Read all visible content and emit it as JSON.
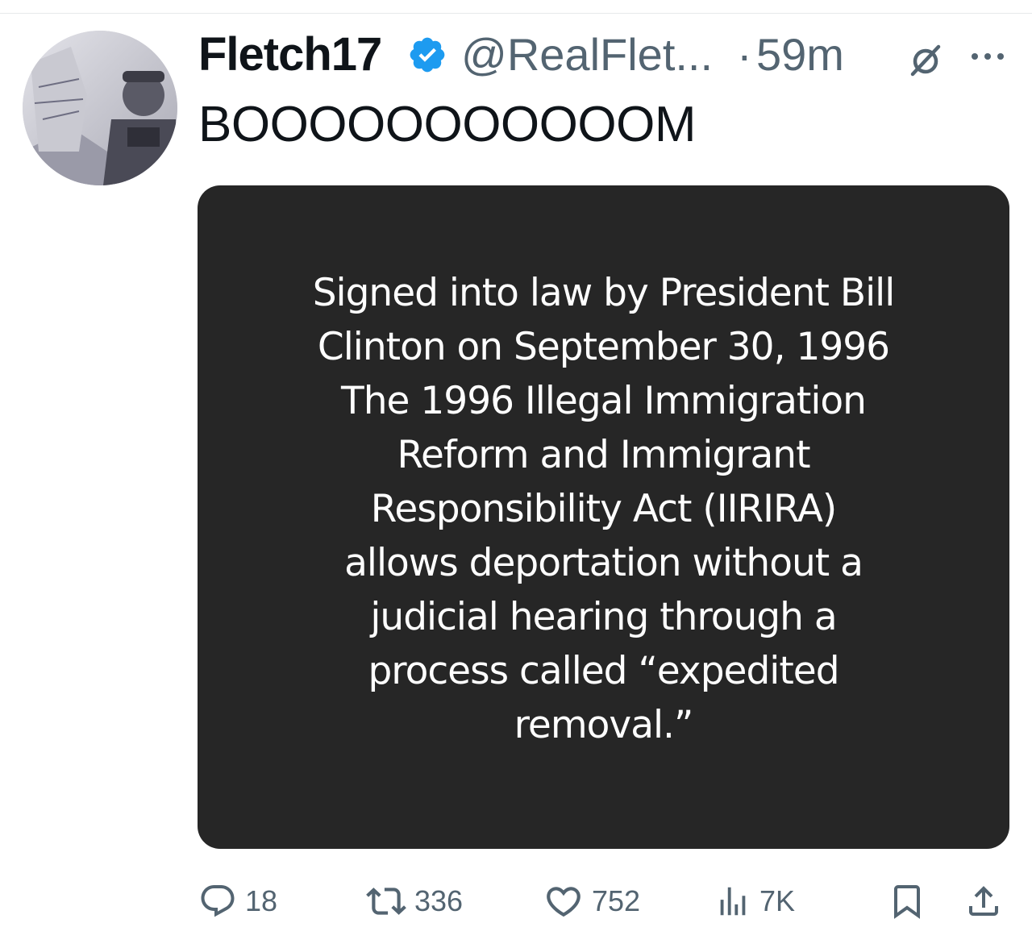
{
  "tweet": {
    "display_name": "Fletch17",
    "handle": "@RealFlet...",
    "separator": "·",
    "timestamp": "59m",
    "text": "BOOOOOOOOOOOM",
    "verified": true,
    "media": {
      "lines": [
        "Signed into law by President Bill",
        "Clinton on September 30, 1996",
        "The 1996 Illegal Immigration",
        "Reform and Immigrant",
        "Responsibility Act (IIRIRA)",
        "allows deportation without a",
        "judicial hearing through a",
        "process called “expedited",
        "removal.”"
      ]
    },
    "actions": {
      "replies": "18",
      "retweets": "336",
      "likes": "752",
      "views": "7K"
    }
  },
  "colors": {
    "verified_blue": "#1d9bf0",
    "secondary_text": "#536471",
    "media_background": "#262626"
  },
  "icons": {
    "verified": "verified-badge-icon",
    "grok": "grok-icon",
    "more": "more-icon",
    "reply": "reply-icon",
    "retweet": "retweet-icon",
    "like": "heart-icon",
    "views": "views-chart-icon",
    "bookmark": "bookmark-icon",
    "share": "share-icon"
  }
}
